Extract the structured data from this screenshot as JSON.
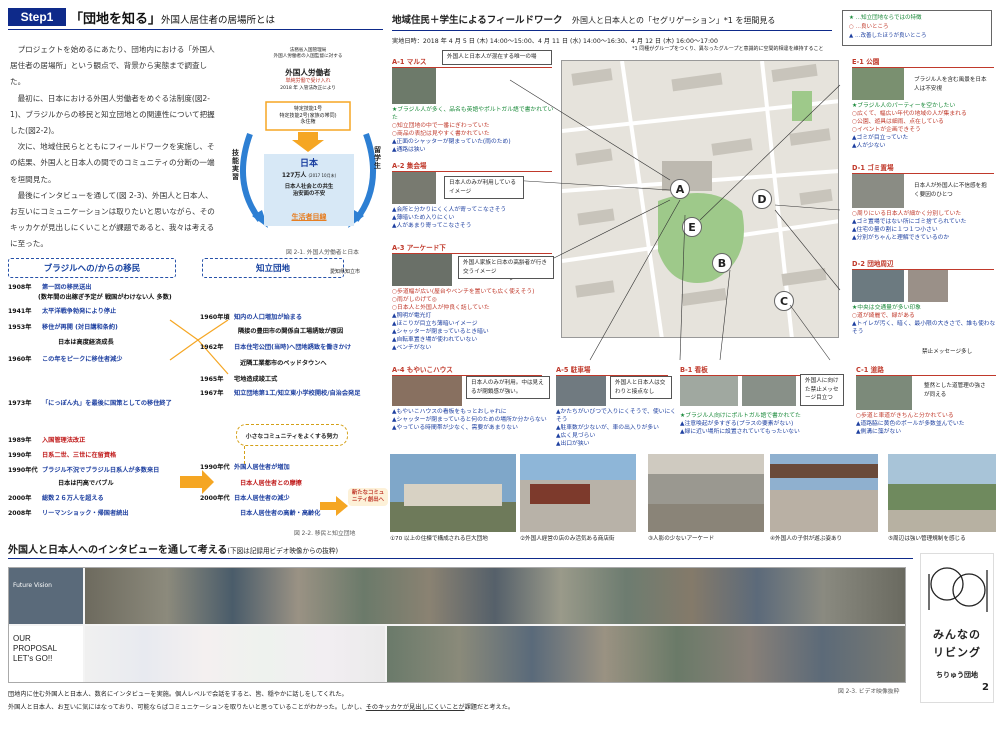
{
  "header": {
    "step_label": "Step1",
    "title": "「団地を知る」",
    "subtitle": "外国人居住者の居場所とは"
  },
  "intro": {
    "paragraphs": [
      "プロジェクトを始めるにあたり、団地内における「外国人居住者の居場所」という観点で、背景から実態まで調査した。",
      "最初に、日本における外国人労働者をめぐる法制度(図2-1)、ブラジルからの移民と知立団地との関連性について把握した(図2-2)。",
      "次に、地域住民らとともにフィールドワークを実施し、その結果、外国人と日本人の間でのコミュニティの分断の一端を垣間見た。",
      "最後にインタビューを通して(図 2-3)、外国人と日本人、お互いにコミュニケーションは取りたいと思いながら、そのキッカケが見出しにくいことが課題であると、我々は考えるに至った。"
    ]
  },
  "fig1": {
    "top_note1": "法務省入国管理局",
    "top_note2": "外国人労働者の入国監督に対する",
    "top_label": "外国人労働者",
    "top_note3": "単純労働で受け入れ",
    "top_note4": "2018 年 入管法改正により",
    "mid1": "特定技能1号",
    "mid2": "↓",
    "mid3": "特定技能2号(家族の帯同)",
    "mid4": "↓",
    "mid5": "永住権",
    "center_title": "日本",
    "center_count": "127万人",
    "center_count_note": "(2017 10月末)",
    "bottom1": "日本人社会との共生",
    "bottom2": "治安面の不安",
    "bottom_goal": "生活者目線",
    "left_label": "技能実習",
    "right_label": "留学生",
    "caption": "図 2-1. 外国人労働者と日本"
  },
  "brazil": {
    "header": "ブラジルへの/からの移民",
    "rows": [
      {
        "year": "1908年",
        "text": "第一回の移民送出",
        "cls": "blue"
      },
      {
        "year": "",
        "text": "(数年間の出稼ぎ予定が 戦国がわけない人 多数)",
        "cls": "blk"
      },
      {
        "year": "1941年",
        "text": "太平洋戦争勃発により停止",
        "cls": "blue"
      },
      {
        "year": "1953年",
        "text": "移住が再開 (対日講和条約)",
        "cls": "blue"
      },
      {
        "year": "",
        "text": "日本は高度経済成長",
        "cls": "blk"
      },
      {
        "year": "1960年",
        "text": "この年をピークに移住者減少",
        "cls": "blue"
      },
      {
        "year": "1973年",
        "text": "「にっぽん丸」を最後に国策としての移住終了",
        "cls": "blue"
      },
      {
        "year": "1989年",
        "text": "入国管理法改正",
        "cls": "red"
      },
      {
        "year": "1990年",
        "text": "日系二世、三世に在留資格",
        "cls": "red"
      },
      {
        "year": "1990年代",
        "text": "ブラジル不況でブラジル日系人が多数来日",
        "cls": "blue"
      },
      {
        "year": "",
        "text": "日本は円高でバブル",
        "cls": "blk"
      },
      {
        "year": "2000年",
        "text": "総数２６万人を超える",
        "cls": "blue"
      },
      {
        "year": "2008年",
        "text": "リーマンショック・帰国者続出",
        "cls": "blue"
      }
    ]
  },
  "chiryu": {
    "header": "知立団地",
    "header_note": "愛知県知立市",
    "rows": [
      {
        "year": "1960年頃",
        "text": "知内の人口増加が始まる",
        "cls": "blue"
      },
      {
        "year": "",
        "text": "隣接の豊田市の関係自工場誘致が原因",
        "cls": "blk"
      },
      {
        "year": "1962年",
        "text": "日本住宅公団(当時)へ団地誘致を働きかけ",
        "cls": "blue"
      },
      {
        "year": "",
        "text": "近隣工業都市のベッドタウンへ",
        "cls": "blk"
      },
      {
        "year": "1965年",
        "text": "宅地造成竣工式",
        "cls": "blk"
      },
      {
        "year": "1967年",
        "text": "知立団地第1工/知立東小学校開校/自治会発足",
        "cls": "blue"
      },
      {
        "year": "1990年代",
        "text": "外国人居住者が増加",
        "cls": "blue"
      },
      {
        "year": "",
        "text": "日本人居住者との摩擦",
        "cls": "red"
      },
      {
        "year": "2000年代",
        "text": "日本人居住者の減少",
        "cls": "blue"
      },
      {
        "year": "",
        "text": "日本人居住者の高齢・高齢化",
        "cls": "blue"
      }
    ],
    "community": "小さなコミュニティをよくする努力",
    "new_label": "新たなコミュニティ創出へ",
    "caption": "図 2-2. 移民と知立団地"
  },
  "fieldwork": {
    "title": "地域住民＋学生によるフィールドワーク",
    "subtitle": "外国人と日本人との「セグリゲーション」*1 を垣間見る",
    "date": "実地日時：2018 年 4 月 5 日 (木) 14:00〜15:00、4 月 11 日 (水) 14:00〜16:30、4 月 12 日 (木) 16:00〜17:00",
    "footnote": "*1 同種がグループをつくり、異なったグループと意識的に空間的相違を維持すること",
    "legend": [
      "★ …知立団地ならではの特徴",
      "○ …良いところ",
      "▲ …改善したほうが良いところ"
    ]
  },
  "spots": {
    "a1": {
      "label": "A-1 マルス",
      "bubble": "外国人と日本人が混在する唯一の場",
      "notes": [
        "★ブラジル人が多く、品名も英語やポルトガル語で書かれていた",
        "○知立団地の中で一番にぎわっていた",
        "○商品の表記は見やすく書かれていた",
        "▲正面のシャッターが閉まっていた(雨のため)",
        "▲通路は狭い"
      ]
    },
    "a2": {
      "label": "A-2 集会場",
      "bubble": "日本人のみが利用しているイメージ",
      "notes": [
        "▲会所と分かりにくく人が寄ってこなさそう",
        "▲薄暗いため入りにくい",
        "▲人があまり寄ってこなさそう"
      ]
    },
    "a3": {
      "label": "A-3 アーケード下",
      "bubble": "外国人家族と日本の高齢者が行き交うイメージ",
      "notes": [
        "○歩道幅が広い(屋台やベンチを置いても広く使えそう)",
        "○雨がしのげて◎",
        "○日本人と外国人が仲良く話していた",
        "▲照明が電光灯",
        "▲ほこりが目立ち薄暗いイメージ",
        "▲シャッターが閉まっているとき暗い",
        "▲自転車置き場が使われていない",
        "▲ベンチがない"
      ]
    },
    "a4": {
      "label": "A-4 もやいこハウス",
      "bubble": "日本人のみが利用。中は見えるが閉鎖感が強い。",
      "notes": [
        "▲もやいこハウスの看板をもっとおしゃれに",
        "▲シャッターが閉まっていると何のための場所か分からない",
        "▲やっている時間帯が少なく、需要があまりない"
      ]
    },
    "a5": {
      "label": "A-5 駐車場",
      "bubble": "外国人と日本人は交わりと接点なし",
      "notes": [
        "▲かたちがいびつで入りにくそうで、使いにくそう",
        "▲駐車数が少ないが、車の出入りが多い",
        "▲広く見づらい",
        "▲出口が狭い"
      ]
    },
    "b1": {
      "label": "B-1 看板",
      "bubble": "外国人に向けた禁止メッセージ目立つ",
      "notes": [
        "★ブラジル人向けにポルトガル語で書かれてた",
        "▲注意喚起が多すぎる(プラスの要素がない)",
        "▲緑に近い場所に設置されていてもったいない"
      ]
    },
    "c1": {
      "label": "C-1 道路",
      "bubble": "整然とした道管理の強さが同える",
      "notes": [
        "○歩道と車道がきちんと分かれている",
        "▲道路脇に黄色のポールが多数並んでいた",
        "▲側溝に藻がない"
      ]
    },
    "d1": {
      "label": "D-1 ゴミ置場",
      "bubble": "日本人が外国人に不信感を抱く要因のひとつ",
      "notes": [
        "○周りにいる日本人が細かく分別していた",
        "▲ゴミ置場ではない所にゴミ捨てられていた",
        "▲住宅の量の割に１つ１つ小さい",
        "▲分別がちゃんと理解できているのか"
      ]
    },
    "d2": {
      "label": "D-2 団地周辺",
      "bubble": "禁止メッセージ多し",
      "notes": [
        "★中央は交通量が多い印象",
        "○道が綺麗で、緑がある",
        "▲トイレが汚く、暗く、最小限の大きさで、誰も使わなそう"
      ]
    },
    "e1": {
      "label": "E-1 公園",
      "bubble": "ブラジル人を含む風景を日本人は不安視",
      "notes": [
        "★ブラジル人のパーティーを空かしたい",
        "○広くて、幅広い年代の地域の人が集まれる",
        "○公園、遊具は細雨、点在している",
        "○イベントが企画できそう",
        "▲ゴミが目立っていた",
        "▲人が少ない"
      ]
    },
    "map_points": [
      "A",
      "B",
      "C",
      "D",
      "E"
    ]
  },
  "bottom_photos": [
    {
      "caption": "①70 以上の住棟で構成される巨大団地"
    },
    {
      "caption": "②外国人経営の店のみ活気ある商店街"
    },
    {
      "caption": "③人影の少ないアーケード"
    },
    {
      "caption": "④外国人の子供が遊ぶ姿あり"
    },
    {
      "caption": "⑤周辺は強い管理規制を感じる"
    }
  ],
  "interview": {
    "title": "外国人と日本人へのインタビューを通して考える",
    "subtitle": "(下図は記録用ビデオ映像からの抜粋)",
    "future_label": "Future Vision",
    "proposal": [
      "OUR",
      "PROPOSAL",
      "LET's GO!!"
    ],
    "caption": "図 2-3. ビデオ映像抜粋"
  },
  "brand": {
    "line1": "みんなの",
    "line2": "リビング",
    "line3": "ちりゅう団地",
    "page": "2"
  },
  "bottom_text": [
    "団地内に住む外国人と日本人、数名にインタビューを実施。個人レベルで会話をすると、皆、穏やかに話しをしてくれた。",
    "外国人と日本人、お互いに気にはなっており、可能ならばコミュニケーションを取りたいと思っていることがわかった。しかし、",
    "そのキッカケが見出しにくいことが",
    "課題だと考えた。"
  ],
  "colors": {
    "badge": "#0e2a8a",
    "accent_red": "#c0392b",
    "accent_blue": "#1d3fa0",
    "arrow_orange": "#f5a623"
  }
}
